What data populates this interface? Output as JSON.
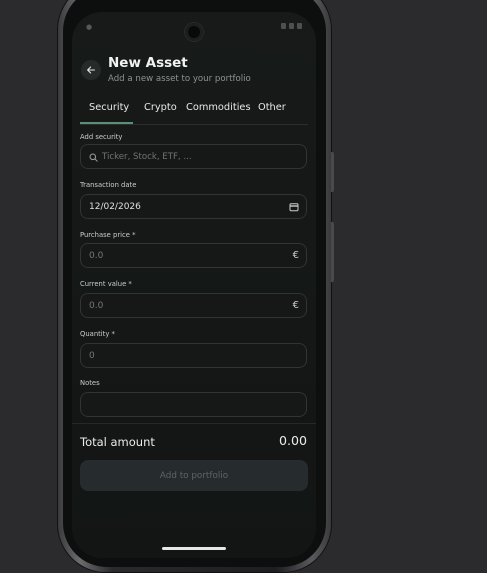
{
  "header": {
    "title": "New Asset",
    "subtitle": "Add a new asset to your portfolio"
  },
  "tabs": [
    {
      "label": "Security",
      "active": true
    },
    {
      "label": "Crypto",
      "active": false
    },
    {
      "label": "Commodities",
      "active": false
    },
    {
      "label": "Other",
      "active": false
    }
  ],
  "form": {
    "security": {
      "label": "Add security",
      "placeholder": "Ticker, Stock, ETF, ..."
    },
    "date": {
      "label": "Transaction date",
      "value": "12/02/2026"
    },
    "purchase_price": {
      "label": "Purchase price *",
      "value": "0.0",
      "currency": "€"
    },
    "current_value": {
      "label": "Current value *",
      "value": "0.0",
      "currency": "€"
    },
    "quantity": {
      "label": "Quantity *",
      "value": "0"
    },
    "notes": {
      "label": "Notes",
      "value": ""
    }
  },
  "summary": {
    "total_label": "Total amount",
    "total_value": "0.00"
  },
  "actions": {
    "add_label": "Add to portfolio"
  },
  "colors": {
    "background": "#2b2b2d",
    "screen": "#151817",
    "accent": "#5c8f78",
    "button": "#262b2d"
  },
  "icons": {
    "back": "arrow-left-icon",
    "search": "search-icon",
    "calendar": "calendar-icon"
  }
}
